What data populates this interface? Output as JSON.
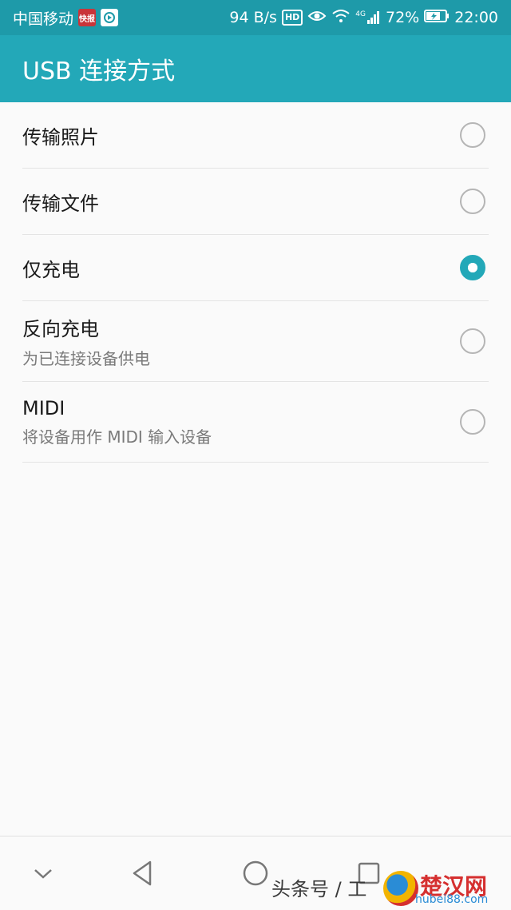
{
  "status_bar": {
    "carrier": "中国移动",
    "news_badge": "快报",
    "speed": "94 B/s",
    "hd_label": "HD",
    "net_type": "4G",
    "battery": "72%",
    "time": "22:00"
  },
  "appbar": {
    "title": "USB 连接方式"
  },
  "options": [
    {
      "title": "传输照片",
      "subtitle": "",
      "selected": false
    },
    {
      "title": "传输文件",
      "subtitle": "",
      "selected": false
    },
    {
      "title": "仅充电",
      "subtitle": "",
      "selected": true
    },
    {
      "title": "反向充电",
      "subtitle": "为已连接设备供电",
      "selected": false
    },
    {
      "title": "MIDI",
      "subtitle": "将设备用作 MIDI 输入设备",
      "selected": false
    }
  ],
  "navbar": {
    "icons": [
      "chevron-down-icon",
      "back-icon",
      "home-icon",
      "recents-icon"
    ]
  },
  "watermark": {
    "text": "头条号 / 工",
    "brand": "楚汉网",
    "url": "hubei88.com"
  },
  "colors": {
    "accent": "#23a8b8",
    "statusbar": "#1e9aa9"
  }
}
